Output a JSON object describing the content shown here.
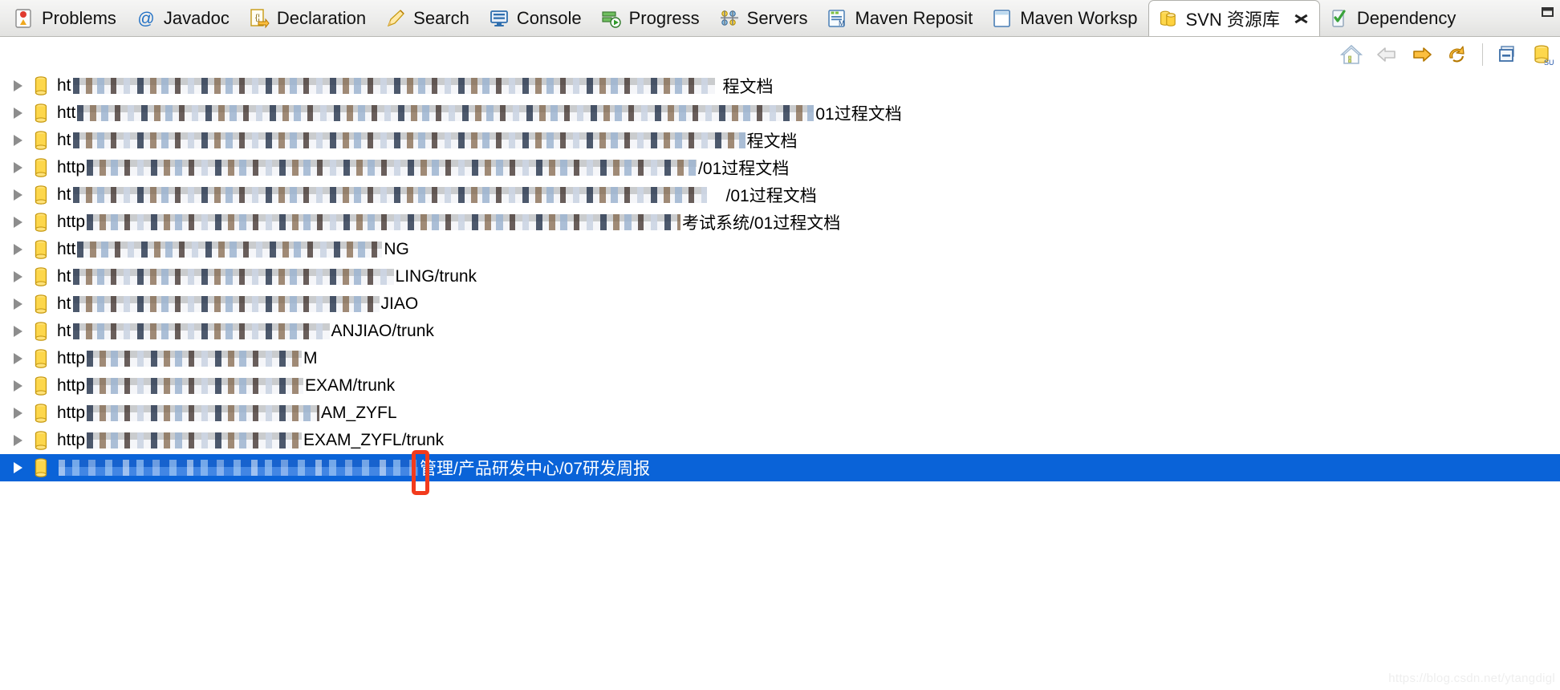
{
  "window": {
    "minimize_glyph": "▭"
  },
  "tabs": [
    {
      "label": "Problems",
      "icon": "problems-icon",
      "active": false
    },
    {
      "label": "Javadoc",
      "icon": "javadoc-at-icon",
      "active": false
    },
    {
      "label": "Declaration",
      "icon": "declaration-icon",
      "active": false
    },
    {
      "label": "Search",
      "icon": "search-pencil-icon",
      "active": false
    },
    {
      "label": "Console",
      "icon": "console-icon",
      "active": false
    },
    {
      "label": "Progress",
      "icon": "progress-icon",
      "active": false
    },
    {
      "label": "Servers",
      "icon": "servers-icon",
      "active": false
    },
    {
      "label": "Maven Reposit",
      "icon": "maven-repository-icon",
      "active": false
    },
    {
      "label": "Maven Worksp",
      "icon": "maven-workspace-icon",
      "active": false
    },
    {
      "label": "SVN 资源库",
      "icon": "svn-repository-icon",
      "active": true,
      "closable": true
    },
    {
      "label": "Dependency",
      "icon": "dependency-icon",
      "active": false
    }
  ],
  "toolbar": {
    "buttons": [
      {
        "name": "home-icon",
        "title": "Home"
      },
      {
        "name": "back-arrow-icon",
        "title": "Back"
      },
      {
        "name": "forward-arrow-icon",
        "title": "Forward"
      },
      {
        "name": "refresh-icon",
        "title": "Refresh"
      },
      {
        "name": "collapse-all-icon",
        "title": "Collapse All"
      },
      {
        "name": "new-repository-location-icon",
        "title": "New Repository Location"
      }
    ]
  },
  "tree": {
    "rows": [
      {
        "prefix": "ht",
        "mosaic": 800,
        "suffix": "程文档",
        "gap": 8,
        "selected": false
      },
      {
        "prefix": "htt",
        "mosaic": 918,
        "suffix": "01过程文档",
        "gap": 0,
        "selected": false
      },
      {
        "prefix": "ht",
        "mosaic": 838,
        "suffix": "程文档",
        "gap": 0,
        "selected": false
      },
      {
        "prefix": "http",
        "mosaic": 760,
        "suffix": "/01过程文档",
        "gap": 0,
        "selected": false
      },
      {
        "prefix": "ht",
        "mosaic": 790,
        "suffix": "/01过程文档",
        "gap": 22,
        "selected": false
      },
      {
        "prefix": "http",
        "mosaic": 740,
        "suffix": "考试系统/01过程文档",
        "gap": 0,
        "selected": false
      },
      {
        "prefix": "htt",
        "mosaic": 380,
        "suffix": "NG",
        "gap": 0,
        "selected": false
      },
      {
        "prefix": "ht",
        "mosaic": 400,
        "suffix": "LING/trunk",
        "gap": 0,
        "selected": false
      },
      {
        "prefix": "ht",
        "mosaic": 382,
        "suffix": "JIAO",
        "gap": 0,
        "selected": false
      },
      {
        "prefix": "ht",
        "mosaic": 320,
        "suffix": "ANJIAO/trunk",
        "gap": 0,
        "selected": false
      },
      {
        "prefix": "http",
        "mosaic": 268,
        "suffix": "M",
        "gap": 0,
        "selected": false
      },
      {
        "prefix": "http",
        "mosaic": 270,
        "suffix": "EXAM/trunk",
        "gap": 0,
        "selected": false
      },
      {
        "prefix": "http",
        "mosaic": 290,
        "suffix": "AM_ZYFL",
        "gap": 0,
        "selected": false
      },
      {
        "prefix": "http",
        "mosaic": 268,
        "suffix": "EXAM_ZYFL/trunk",
        "gap": 0,
        "selected": false
      },
      {
        "prefix": "",
        "mosaic": 448,
        "suffix": "管理/产品研发中心/07研发周报",
        "gap": 0,
        "selected": true
      }
    ]
  },
  "annotation": {
    "color": "#f23b1d",
    "target_row_index": 14
  },
  "watermark": {
    "text": "https://blog.csdn.net/ytangdigl"
  }
}
